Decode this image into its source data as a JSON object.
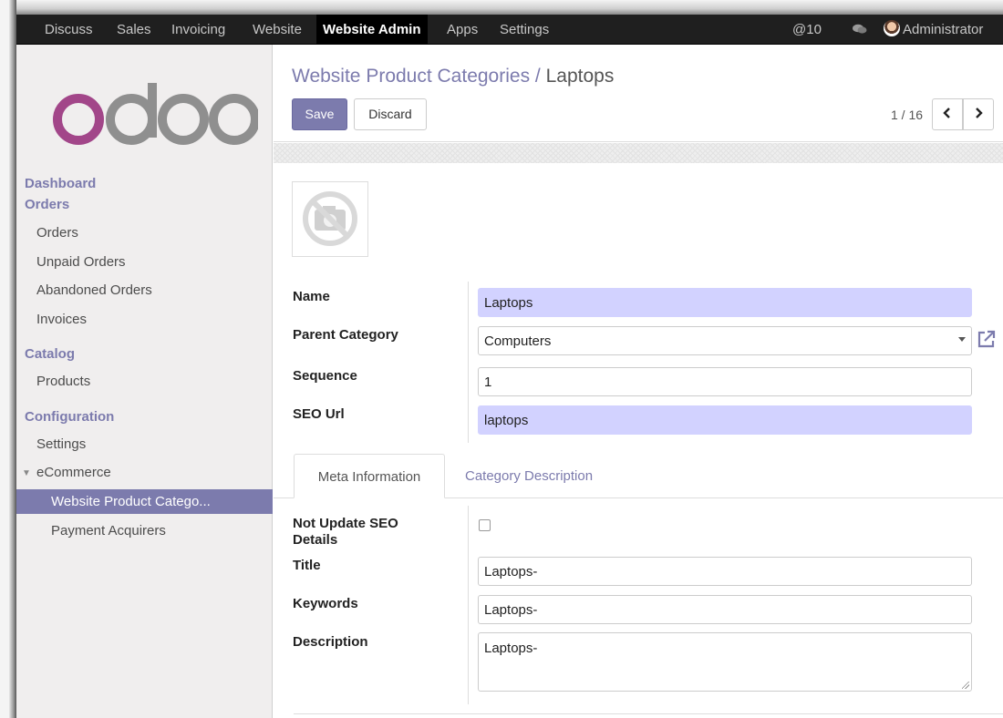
{
  "topbar": {
    "menu": [
      "Discuss",
      "Sales",
      "Invoicing",
      "Website",
      "Website Admin",
      "Apps",
      "Settings"
    ],
    "active_menu": "Website Admin",
    "mentions_count": "@10",
    "user": "Administrator",
    "icons": [
      "chat-icon",
      "avatar"
    ]
  },
  "sidebar": {
    "logo_text": "odoo",
    "sections": {
      "dashboard": "Dashboard",
      "orders": "Orders",
      "catalog": "Catalog",
      "configuration": "Configuration"
    },
    "items": {
      "orders": "Orders",
      "unpaid_orders": "Unpaid Orders",
      "abandoned_orders": "Abandoned Orders",
      "invoices": "Invoices",
      "products": "Products",
      "settings": "Settings",
      "ecommerce": "eCommerce",
      "website_product_categories": "Website Product Catego...",
      "payment_acquirers": "Payment Acquirers"
    }
  },
  "control_panel": {
    "breadcrumb_parent": "Website Product Categories",
    "breadcrumb_sep": "/",
    "breadcrumb_current": "Laptops",
    "save_label": "Save",
    "discard_label": "Discard",
    "pager": "1 / 16",
    "prev_glyph": "‹",
    "next_glyph": "›"
  },
  "form": {
    "image_placeholder": "no-image-camera-icon",
    "name_label": "Name",
    "name_value": "Laptops",
    "parent_label": "Parent Category",
    "parent_value": "Computers",
    "sequence_label": "Sequence",
    "sequence_value": "1",
    "seo_url_label": "SEO Url",
    "seo_url_value": "laptops",
    "tabs": {
      "meta": "Meta Information",
      "description": "Category Description"
    },
    "meta": {
      "not_update_label_1": "Not Update SEO",
      "not_update_label_2": "Details",
      "not_update_checked": false,
      "title_label": "Title",
      "title_value": "Laptops-",
      "keywords_label": "Keywords",
      "keywords_value": "Laptops-",
      "description_label": "Description",
      "description_value": "Laptops-"
    }
  },
  "colors": {
    "accent": "#7c7bad",
    "navbar": "#1f1f1f",
    "required_field": "#d2d2ff",
    "sidebar_bg": "#f0eeee"
  }
}
